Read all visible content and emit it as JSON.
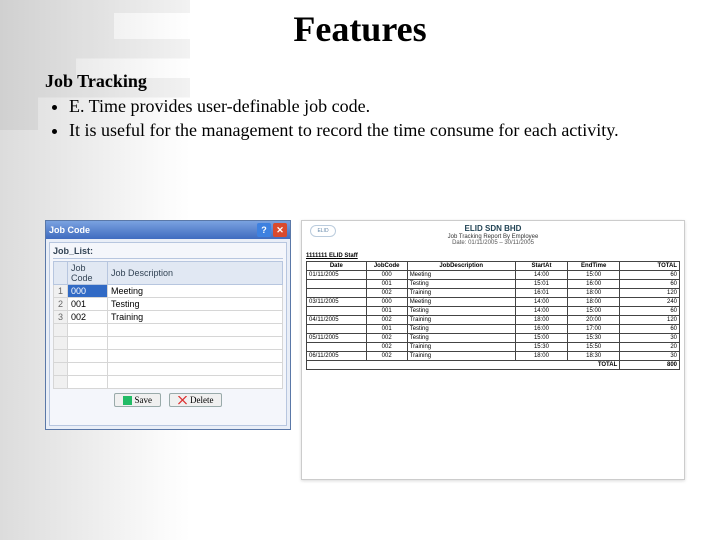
{
  "title": "Features",
  "subhead": "Job Tracking",
  "bullets": [
    "E. Time provides user-definable job code.",
    "It is useful for the management to record the time consume for each activity."
  ],
  "dialog": {
    "window_title": "Job Code",
    "panel_title": "Job_List:",
    "headers": {
      "code": "Job Code",
      "desc": "Job Description"
    },
    "rows": [
      {
        "n": "1",
        "code": "000",
        "desc": "Meeting"
      },
      {
        "n": "2",
        "code": "001",
        "desc": "Testing"
      },
      {
        "n": "3",
        "code": "002",
        "desc": "Training"
      }
    ],
    "save_label": "Save",
    "delete_label": "Delete"
  },
  "report": {
    "logo": "ELID",
    "company": "ELID SDN BHD",
    "report_title": "Job Tracking Report By Employee",
    "date_range": "Date: 01/11/2005 – 30/11/2005",
    "employee": "1111111  ELID Staff",
    "cols": {
      "date": "Date",
      "code": "JobCode",
      "desc": "JobDescription",
      "start": "StartAt",
      "end": "EndTime",
      "total": "TOTAL"
    },
    "rows": [
      {
        "date": "01/11/2005",
        "code": "000",
        "desc": "Meeting",
        "start": "14:00",
        "end": "15:00",
        "total": "60"
      },
      {
        "date": "",
        "code": "001",
        "desc": "Testing",
        "start": "15:01",
        "end": "16:00",
        "total": "60"
      },
      {
        "date": "",
        "code": "002",
        "desc": "Training",
        "start": "16:01",
        "end": "18:00",
        "total": "120"
      },
      {
        "date": "03/11/2005",
        "code": "000",
        "desc": "Meeting",
        "start": "14:00",
        "end": "18:00",
        "total": "240"
      },
      {
        "date": "",
        "code": "001",
        "desc": "Testing",
        "start": "14:00",
        "end": "15:00",
        "total": "60"
      },
      {
        "date": "04/11/2005",
        "code": "002",
        "desc": "Training",
        "start": "18:00",
        "end": "20:00",
        "total": "120"
      },
      {
        "date": "",
        "code": "001",
        "desc": "Testing",
        "start": "16:00",
        "end": "17:00",
        "total": "60"
      },
      {
        "date": "05/11/2005",
        "code": "002",
        "desc": "Testing",
        "start": "15:00",
        "end": "15:30",
        "total": "30"
      },
      {
        "date": "",
        "code": "002",
        "desc": "Training",
        "start": "15:30",
        "end": "15:50",
        "total": "20"
      },
      {
        "date": "06/11/2005",
        "code": "002",
        "desc": "Training",
        "start": "18:00",
        "end": "18:30",
        "total": "30"
      }
    ],
    "total_label": "TOTAL",
    "grand_total": "800"
  }
}
